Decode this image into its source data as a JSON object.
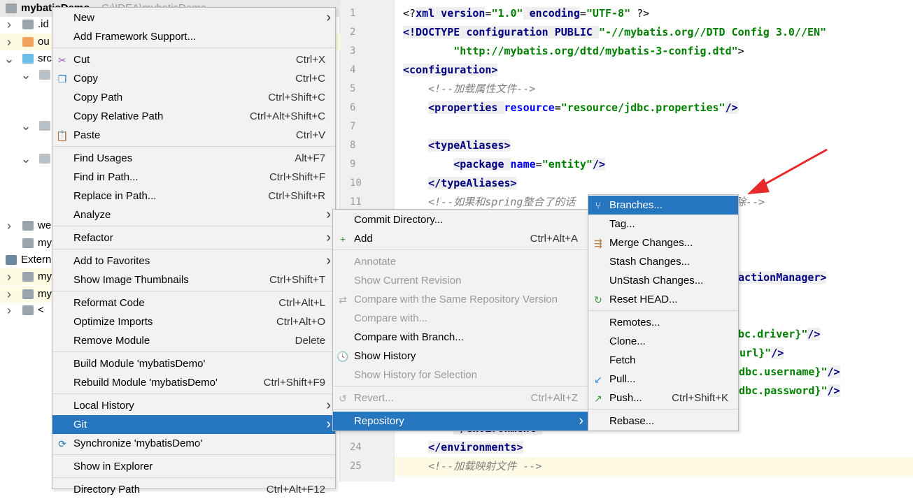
{
  "tree": {
    "project_name": "mybatisDemo",
    "project_path": "C:\\IDEA\\mybatisDemo",
    "rows": [
      {
        "label": ".id",
        "arrow": "right",
        "icon": "folder-gray"
      },
      {
        "label": "ou",
        "arrow": "right",
        "icon": "folder-orange",
        "hl": true
      },
      {
        "label": "src",
        "arrow": "down",
        "icon": "folder-blue"
      },
      {
        "label": "",
        "arrow": "down",
        "icon": "folder-package",
        "indent": 1
      },
      {
        "label": "",
        "arrow": "down",
        "icon": "folder-package",
        "indent": 1
      },
      {
        "label": "",
        "arrow": "down",
        "icon": "folder-package",
        "indent": 1
      },
      {
        "label": "",
        "arrow": "",
        "icon": "class-c",
        "indent": 2
      },
      {
        "label": "we",
        "arrow": "right",
        "icon": "folder-web"
      },
      {
        "label": "my",
        "arrow": "",
        "icon": "file"
      },
      {
        "label": "Extern",
        "arrow": "",
        "icon": "library",
        "indent": -1
      },
      {
        "label": "my",
        "arrow": "right",
        "icon": "jar",
        "hl": true
      },
      {
        "label": "my",
        "arrow": "right",
        "icon": "jar",
        "hl": true
      },
      {
        "label": "< ",
        "arrow": "right",
        "icon": "jdk"
      }
    ]
  },
  "editor": {
    "lines": [
      {
        "n": "1",
        "tokens": [
          [
            "<?",
            "pl"
          ],
          [
            "xml version",
            "tag"
          ],
          [
            "=",
            "pl"
          ],
          [
            "\"1.0\"",
            "val"
          ],
          [
            " encoding",
            "tag"
          ],
          [
            "=",
            "pl"
          ],
          [
            "\"UTF-8\"",
            "val"
          ],
          [
            " ?>",
            "pl"
          ]
        ]
      },
      {
        "n": "2",
        "tokens": [
          [
            "<!DOCTYPE ",
            "tag"
          ],
          [
            "configuration PUBLIC ",
            "tag"
          ],
          [
            "\"-//mybatis.org//DTD Config 3.0//EN\"",
            "val"
          ]
        ]
      },
      {
        "n": "3",
        "tokens": [
          [
            "        \"http://mybatis.org/dtd/mybatis-3-config.dtd\"",
            "val"
          ],
          [
            ">",
            "pl"
          ]
        ]
      },
      {
        "n": "4",
        "tokens": [
          [
            "<configuration>",
            "tag"
          ]
        ]
      },
      {
        "n": "5",
        "tokens": [
          [
            "    ",
            "pl"
          ],
          [
            "<!--加载属性文件-->",
            "com"
          ]
        ]
      },
      {
        "n": "6",
        "tokens": [
          [
            "    ",
            "pl"
          ],
          [
            "<properties ",
            "tag"
          ],
          [
            "resource",
            "attr"
          ],
          [
            "=",
            "pl"
          ],
          [
            "\"resource/jdbc.properties\"",
            "val"
          ],
          [
            "/>",
            "tag"
          ]
        ]
      },
      {
        "n": "7",
        "tokens": []
      },
      {
        "n": "8",
        "tokens": [
          [
            "    ",
            "pl"
          ],
          [
            "<typeAliases>",
            "tag"
          ]
        ]
      },
      {
        "n": "9",
        "tokens": [
          [
            "        ",
            "pl"
          ],
          [
            "<package ",
            "tag"
          ],
          [
            "name",
            "attr"
          ],
          [
            "=",
            "pl"
          ],
          [
            "\"entity\"",
            "val"
          ],
          [
            "/>",
            "tag"
          ]
        ]
      },
      {
        "n": "10",
        "tokens": [
          [
            "    ",
            "pl"
          ],
          [
            "</typeAliases>",
            "tag"
          ]
        ]
      },
      {
        "n": "11",
        "tokens": [
          [
            "    ",
            "pl"
          ],
          [
            "<!--如果和spring整合了的话",
            "com"
          ]
        ]
      },
      {
        "n": "23",
        "tokens": [
          [
            "        ",
            "pl"
          ],
          [
            "</environment>",
            "tag"
          ]
        ]
      },
      {
        "n": "24",
        "tokens": [
          [
            "    ",
            "pl"
          ],
          [
            "</environments>",
            "tag"
          ]
        ]
      },
      {
        "n": "25",
        "tokens": [
          [
            "    ",
            "pl"
          ],
          [
            "<!--加载映射文件 -->",
            "com"
          ]
        ],
        "current": true
      }
    ],
    "fragments": [
      {
        "line": 11,
        "tokens": [
          [
            "除-->",
            "com"
          ]
        ]
      },
      {
        "line": 15,
        "tokens": [
          [
            "sactionManager>",
            "tag"
          ]
        ]
      },
      {
        "line": 18,
        "tokens": [
          [
            "dbc.driver}\"",
            "val"
          ],
          [
            "/>",
            "tag"
          ]
        ]
      },
      {
        "line": 19,
        "tokens": [
          [
            ".url}\"",
            "val"
          ],
          [
            "/>",
            "tag"
          ]
        ]
      },
      {
        "line": 20,
        "tokens": [
          [
            "{jdbc.username}\"",
            "val"
          ],
          [
            "/>",
            "tag"
          ]
        ]
      },
      {
        "line": 21,
        "tokens": [
          [
            "{jdbc.password}\"",
            "val"
          ],
          [
            "/>",
            "tag"
          ]
        ]
      }
    ]
  },
  "context_menu": {
    "items": [
      {
        "label": "New",
        "sub": true
      },
      {
        "label": "Add Framework Support..."
      },
      {
        "sep": true
      },
      {
        "label": "Cut",
        "shortcut": "Ctrl+X",
        "icon": "scissors-icon",
        "glyph": "✂",
        "color": "#9b59b6"
      },
      {
        "label": "Copy",
        "shortcut": "Ctrl+C",
        "icon": "copy-icon",
        "glyph": "❐",
        "color": "#2a7ab8"
      },
      {
        "label": "Copy Path",
        "shortcut": "Ctrl+Shift+C"
      },
      {
        "label": "Copy Relative Path",
        "shortcut": "Ctrl+Alt+Shift+C"
      },
      {
        "label": "Paste",
        "shortcut": "Ctrl+V",
        "icon": "paste-icon",
        "glyph": "📋",
        "color": "#b07a3a"
      },
      {
        "sep": true
      },
      {
        "label": "Find Usages",
        "shortcut": "Alt+F7"
      },
      {
        "label": "Find in Path...",
        "shortcut": "Ctrl+Shift+F"
      },
      {
        "label": "Replace in Path...",
        "shortcut": "Ctrl+Shift+R"
      },
      {
        "label": "Analyze",
        "sub": true
      },
      {
        "sep": true
      },
      {
        "label": "Refactor",
        "sub": true
      },
      {
        "sep": true
      },
      {
        "label": "Add to Favorites",
        "sub": true
      },
      {
        "label": "Show Image Thumbnails",
        "shortcut": "Ctrl+Shift+T"
      },
      {
        "sep": true
      },
      {
        "label": "Reformat Code",
        "shortcut": "Ctrl+Alt+L"
      },
      {
        "label": "Optimize Imports",
        "shortcut": "Ctrl+Alt+O"
      },
      {
        "label": "Remove Module",
        "shortcut": "Delete"
      },
      {
        "sep": true
      },
      {
        "label": "Build Module 'mybatisDemo'"
      },
      {
        "label": "Rebuild Module 'mybatisDemo'",
        "shortcut": "Ctrl+Shift+F9"
      },
      {
        "sep": true
      },
      {
        "label": "Local History",
        "sub": true
      },
      {
        "label": "Git",
        "sub": true,
        "selected": true
      },
      {
        "label": "Synchronize 'mybatisDemo'",
        "icon": "sync-icon",
        "glyph": "⟳",
        "color": "#2a7ab8"
      },
      {
        "sep": true
      },
      {
        "label": "Show in Explorer"
      },
      {
        "sep": true
      },
      {
        "label": "Directory Path",
        "shortcut": "Ctrl+Alt+F12"
      }
    ]
  },
  "git_menu": {
    "items": [
      {
        "label": "Commit Directory..."
      },
      {
        "label": "Add",
        "shortcut": "Ctrl+Alt+A",
        "icon": "plus-icon",
        "glyph": "+",
        "color": "#3a9a3a"
      },
      {
        "sep": true
      },
      {
        "label": "Annotate",
        "disabled": true
      },
      {
        "label": "Show Current Revision",
        "disabled": true
      },
      {
        "label": "Compare with the Same Repository Version",
        "disabled": true,
        "icon": "compare-icon",
        "glyph": "⇄",
        "color": "#aaa"
      },
      {
        "label": "Compare with...",
        "disabled": true
      },
      {
        "label": "Compare with Branch..."
      },
      {
        "label": "Show History",
        "icon": "history-icon",
        "glyph": "🕓",
        "color": "#2a7ab8"
      },
      {
        "label": "Show History for Selection",
        "disabled": true
      },
      {
        "sep": true
      },
      {
        "label": "Revert...",
        "shortcut": "Ctrl+Alt+Z",
        "disabled": true,
        "icon": "revert-icon",
        "glyph": "↺",
        "color": "#aaa"
      },
      {
        "sep": true
      },
      {
        "label": "Repository",
        "sub": true,
        "selected": true
      }
    ]
  },
  "repo_menu": {
    "items": [
      {
        "label": "Branches...",
        "selected": true,
        "icon": "branch-icon",
        "glyph": "⑂",
        "color": "#fff"
      },
      {
        "label": "Tag..."
      },
      {
        "label": "Merge Changes...",
        "icon": "merge-icon",
        "glyph": "⇶",
        "color": "#b07a3a"
      },
      {
        "label": "Stash Changes..."
      },
      {
        "label": "UnStash Changes..."
      },
      {
        "label": "Reset HEAD...",
        "icon": "reset-icon",
        "glyph": "↻",
        "color": "#3a9a3a"
      },
      {
        "sep": true
      },
      {
        "label": "Remotes..."
      },
      {
        "label": "Clone..."
      },
      {
        "label": "Fetch"
      },
      {
        "label": "Pull...",
        "icon": "pull-icon",
        "glyph": "↙",
        "color": "#2a8ad8"
      },
      {
        "label": "Push...",
        "shortcut": "Ctrl+Shift+K",
        "icon": "push-icon",
        "glyph": "↗",
        "color": "#3a9a3a"
      },
      {
        "sep": true
      },
      {
        "label": "Rebase..."
      }
    ]
  },
  "colors": {
    "selection": "#2675bf",
    "annotation_arrow": "#e8292a"
  }
}
